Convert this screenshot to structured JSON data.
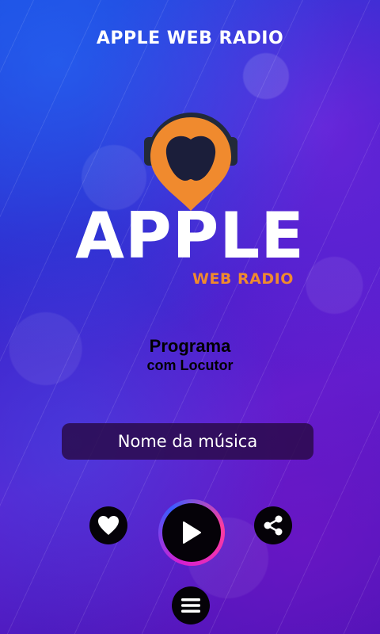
{
  "app": {
    "title": "APPLE WEB RADIO"
  },
  "logo": {
    "wordmark": "APPLE",
    "subtitle": "WEB RADIO"
  },
  "program": {
    "name": "Programa",
    "host": "com Locutor"
  },
  "now_playing": {
    "song": "Nome da música"
  },
  "controls": {
    "favorite_icon": "heart-icon",
    "play_icon": "play-icon",
    "share_icon": "share-icon",
    "menu_icon": "menu-icon"
  },
  "colors": {
    "accent_orange": "#f08a2e",
    "button_dark": "#050208",
    "play_ring": "#d51fd0"
  }
}
